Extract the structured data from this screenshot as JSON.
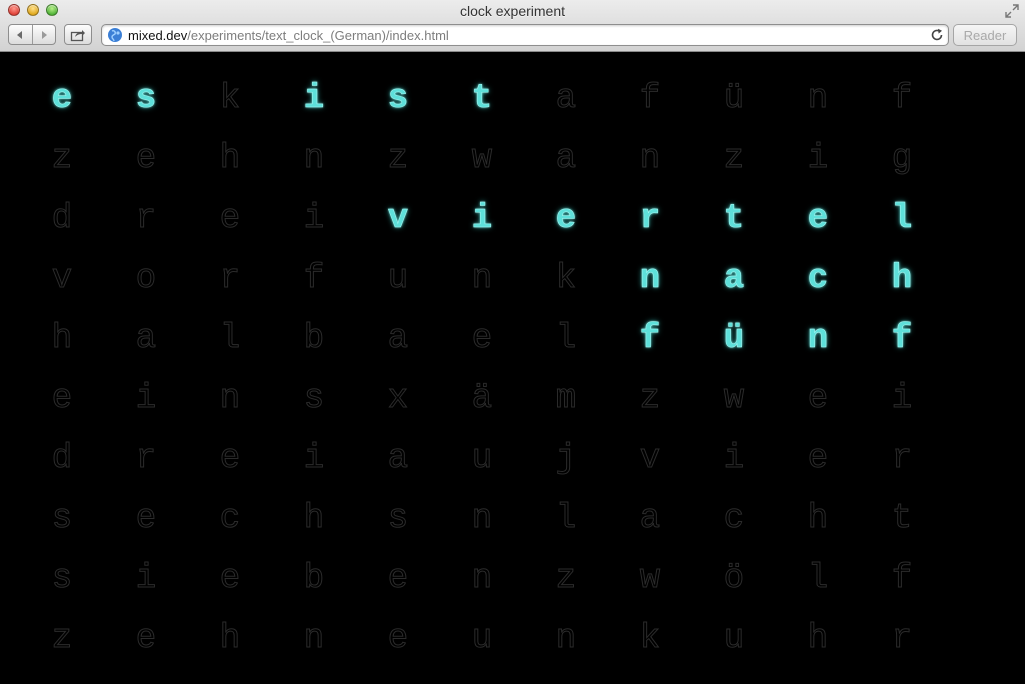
{
  "window": {
    "title": "clock experiment"
  },
  "toolbar": {
    "back_icon": "chevron-left-icon",
    "forward_icon": "chevron-right-icon",
    "share_icon": "share-icon",
    "reload_icon": "reload-icon",
    "reader_label": "Reader"
  },
  "address": {
    "domain": "mixed.dev",
    "path": "/experiments/text_clock_(German)/index.html"
  },
  "colors": {
    "lit": "#5ee0da",
    "unlit_outline": "#2b2b2b",
    "background": "#000000"
  },
  "clock": {
    "rows": [
      [
        "e",
        "s",
        "k",
        "i",
        "s",
        "t",
        "a",
        "f",
        "ü",
        "n",
        "f"
      ],
      [
        "z",
        "e",
        "h",
        "n",
        "z",
        "w",
        "a",
        "n",
        "z",
        "i",
        "g"
      ],
      [
        "d",
        "r",
        "e",
        "i",
        "v",
        "i",
        "e",
        "r",
        "t",
        "e",
        "l"
      ],
      [
        "v",
        "o",
        "r",
        "f",
        "u",
        "n",
        "k",
        "n",
        "a",
        "c",
        "h"
      ],
      [
        "h",
        "a",
        "l",
        "b",
        "a",
        "e",
        "l",
        "f",
        "ü",
        "n",
        "f"
      ],
      [
        "e",
        "i",
        "n",
        "s",
        "x",
        "ä",
        "m",
        "z",
        "w",
        "e",
        "i"
      ],
      [
        "d",
        "r",
        "e",
        "i",
        "a",
        "u",
        "j",
        "v",
        "i",
        "e",
        "r"
      ],
      [
        "s",
        "e",
        "c",
        "h",
        "s",
        "n",
        "l",
        "a",
        "c",
        "h",
        "t"
      ],
      [
        "s",
        "i",
        "e",
        "b",
        "e",
        "n",
        "z",
        "w",
        "ö",
        "l",
        "f"
      ],
      [
        "z",
        "e",
        "h",
        "n",
        "e",
        "u",
        "n",
        "k",
        "u",
        "h",
        "r"
      ]
    ],
    "lit": [
      [
        true,
        true,
        false,
        true,
        true,
        true,
        false,
        false,
        false,
        false,
        false
      ],
      [
        false,
        false,
        false,
        false,
        false,
        false,
        false,
        false,
        false,
        false,
        false
      ],
      [
        false,
        false,
        false,
        false,
        true,
        true,
        true,
        true,
        true,
        true,
        true
      ],
      [
        false,
        false,
        false,
        false,
        false,
        false,
        false,
        true,
        true,
        true,
        true
      ],
      [
        false,
        false,
        false,
        false,
        false,
        false,
        false,
        true,
        true,
        true,
        true
      ],
      [
        false,
        false,
        false,
        false,
        false,
        false,
        false,
        false,
        false,
        false,
        false
      ],
      [
        false,
        false,
        false,
        false,
        false,
        false,
        false,
        false,
        false,
        false,
        false
      ],
      [
        false,
        false,
        false,
        false,
        false,
        false,
        false,
        false,
        false,
        false,
        false
      ],
      [
        false,
        false,
        false,
        false,
        false,
        false,
        false,
        false,
        false,
        false,
        false
      ],
      [
        false,
        false,
        false,
        false,
        false,
        false,
        false,
        false,
        false,
        false,
        false
      ]
    ]
  }
}
